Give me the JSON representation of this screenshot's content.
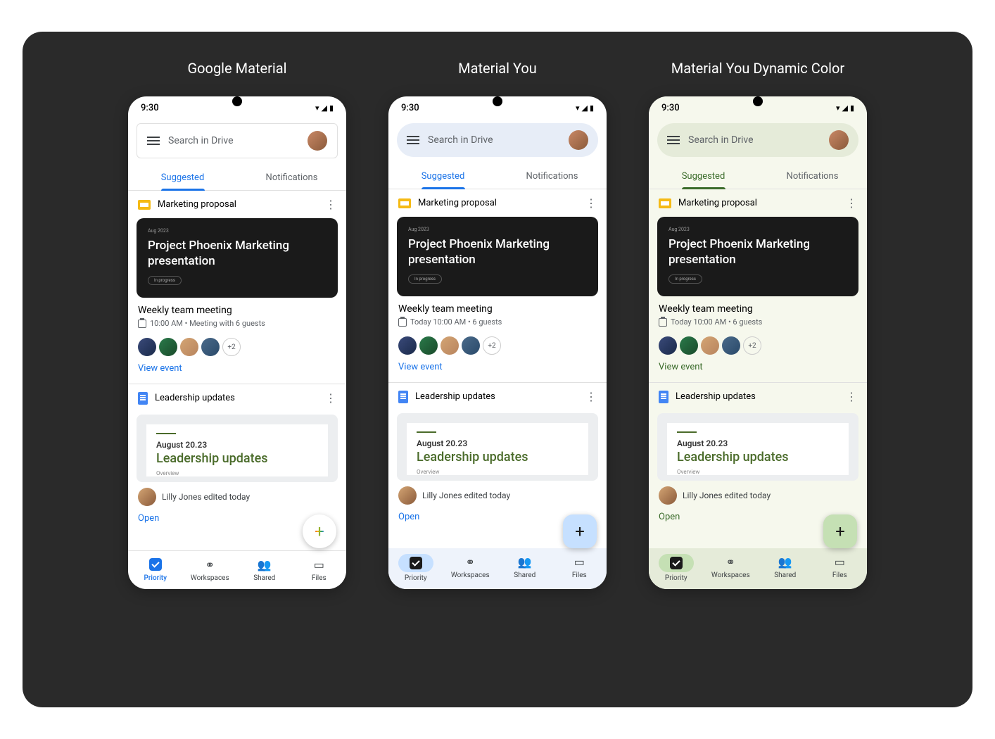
{
  "variants": [
    {
      "title": "Google Material"
    },
    {
      "title": "Material You"
    },
    {
      "title": "Material You Dynamic Color"
    }
  ],
  "statusbar": {
    "time": "9:30"
  },
  "search": {
    "placeholder": "Search in Drive"
  },
  "tabs": {
    "suggested": "Suggested",
    "notifications": "Notifications"
  },
  "card1": {
    "filename": "Marketing proposal",
    "slide_small": "Aug 2023",
    "slide_title": "Project Phoenix Marketing presentation",
    "slide_pill": "In progress"
  },
  "meeting": {
    "title": "Weekly team meeting",
    "sub_v1": "10:00 AM • Meeting with 6 guests",
    "sub_v2": "Today 10:00 AM • 6 guests",
    "sub_v3": "Today 10:00 AM • 6 guests",
    "more": "+2",
    "view_event": "View event"
  },
  "card2": {
    "filename": "Leadership updates",
    "doc_date": "August 20.23",
    "doc_head": "Leadership updates",
    "doc_over": "Overview",
    "editor_text": "Lilly Jones edited today",
    "open": "Open"
  },
  "nav": {
    "priority": "Priority",
    "workspaces": "Workspaces",
    "shared": "Shared",
    "files": "Files"
  }
}
